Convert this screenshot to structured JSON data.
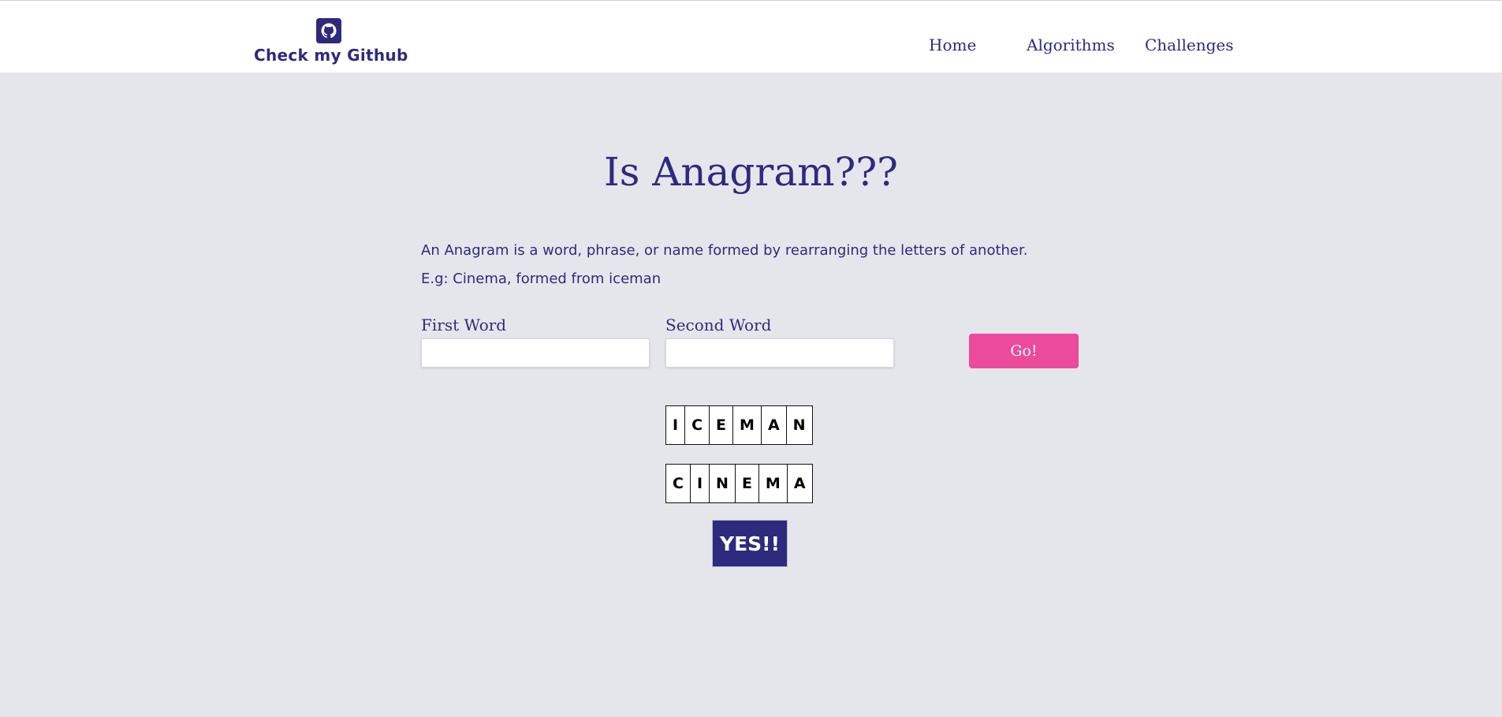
{
  "header": {
    "brand_label": "Check my Github",
    "brand_icon": "github-icon",
    "nav": [
      {
        "label": "Home"
      },
      {
        "label": "Algorithms"
      },
      {
        "label": "Challenges"
      }
    ]
  },
  "main": {
    "title": "Is Anagram???",
    "description": "An Anagram is a word, phrase, or name formed by rearranging the letters of another.",
    "example": "E.g: Cinema, formed from iceman",
    "first_word": {
      "label": "First Word",
      "value": "",
      "placeholder": ""
    },
    "second_word": {
      "label": "Second Word",
      "value": "",
      "placeholder": ""
    },
    "go_label": "Go!",
    "first_letters": [
      "I",
      "C",
      "E",
      "M",
      "A",
      "N"
    ],
    "second_letters": [
      "C",
      "I",
      "N",
      "E",
      "M",
      "A"
    ],
    "result": "YES!!"
  },
  "colors": {
    "primary": "#2e2a7e",
    "accent": "#ec4a9b",
    "background": "#e5e6eb",
    "header_background": "#ffffff"
  }
}
